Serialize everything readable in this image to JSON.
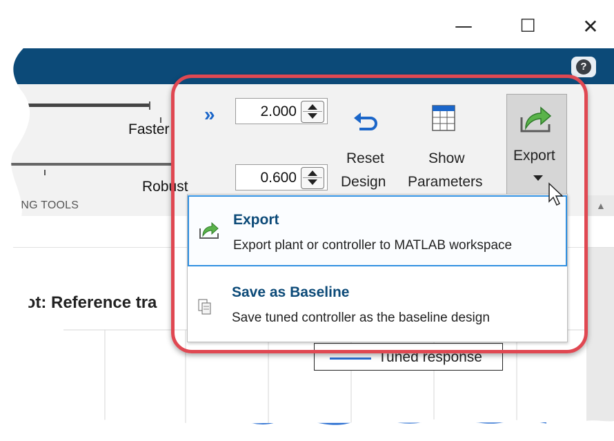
{
  "window_controls": {
    "minimize": "—",
    "maximize": "☐",
    "close": "✕"
  },
  "toolstrip": {
    "help_glyph": "?",
    "slider_top_label": "Faster",
    "slider_bottom_label": "Robust",
    "section_label": "NING TOOLS",
    "expand_glyph": "»",
    "spin_top_value": "2.000",
    "spin_bottom_value": "0.600",
    "reset_label_1": "Reset",
    "reset_label_2": "Design",
    "show_label_1": "Show",
    "show_label_2": "Parameters",
    "export_label": "Export"
  },
  "menu": {
    "items": [
      {
        "title": "Export",
        "desc": "Export plant or controller to MATLAB workspace",
        "icon": "export-icon"
      },
      {
        "title": "Save as Baseline",
        "desc": "Save tuned controller as the baseline design",
        "icon": "save-baseline-icon"
      }
    ]
  },
  "plot": {
    "title": "Plot: Reference tra",
    "legend": "Tuned response"
  },
  "colors": {
    "header": "#0c4a78",
    "highlight": "#e04852",
    "menu_title": "#0c4a78",
    "selection": "#2f8fe0",
    "accent_icon": "#1b66c9"
  }
}
